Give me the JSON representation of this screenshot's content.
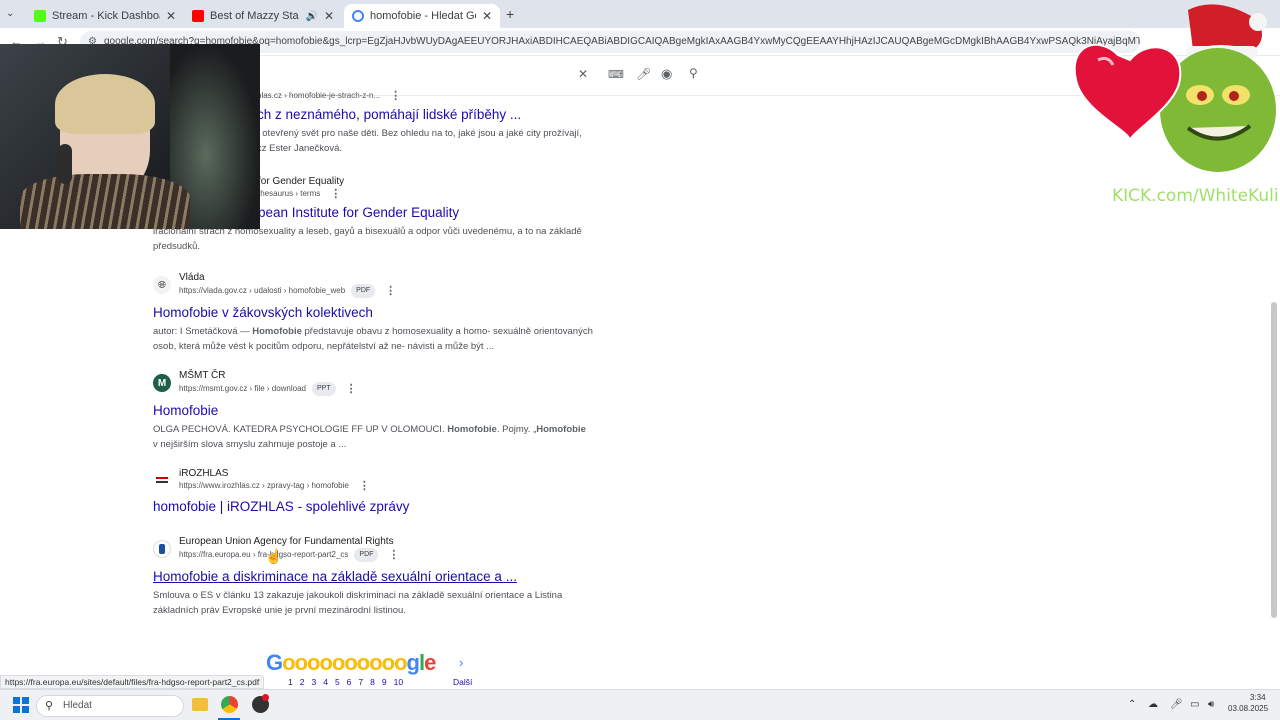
{
  "tabs": [
    {
      "title": "Stream - Kick Dashboard",
      "favicon_color": "#53fc18",
      "active": false
    },
    {
      "title": "Best of Mazzy Star All Time",
      "favicon_color": "#ff0000",
      "active": false
    },
    {
      "title": "homofobie - Hledat Googlem",
      "favicon_color": "#4285f4",
      "active": true
    }
  ],
  "address": {
    "url": "google.com/search?q=homofobie&oq=homofobie&gs_lcrp=EgZjaHJvbWUyDAgAEEUYORJHAxiABDIHCAEQABiABDIGCAIQABgeMgkIAxAAGB4YxwMyCQgEEAAYHhjHAzIJCAUQABgeMGcDMgkIBhAAGB4YxwPSAQk3NjAyajBqMTWoAgiwAgHyBSijnR!I"
  },
  "results": [
    {
      "source": "",
      "url_parts": "hlas.cz › homofobie-je-strach-z-n...",
      "pill": "",
      "title": "ch z neznámého, pomáhají lidské příběhy ...",
      "snippet": "t otevřený svět pro naše děti. Bez ohledu na to, jaké jsou a jaké city prožívají, cz Ester Janečková."
    },
    {
      "source": "for Gender Equality",
      "url_parts": "thesaurus › terms",
      "pill": "",
      "title": "pean Institute for Gender Equality",
      "snippet": "iracionální strach z homosexuality a leseb, gayů a bisexuálů a odpor vůči uvedenému, a to na základě předsudků."
    },
    {
      "source": "Vláda",
      "url_parts": "https://vlada.gov.cz › udalosti › homofobie_web",
      "pill": "PDF",
      "title": "Homofobie v žákovských kolektivech",
      "snippet_a": "autor: I Smetáčková — ",
      "snippet_b": "Homofobie",
      "snippet_c": " představuje obavu z homosexuality a homo- sexuálně orientovaných osob, která může vést k pocitům odporu, nepřátelství až ne- návisti a může být ..."
    },
    {
      "source": "MŠMT ČR",
      "url_parts": "https://msmt.gov.cz › file › download",
      "pill": "PPT",
      "title": "Homofobie",
      "snippet_a": "OLGA PECHOVÁ. KATEDRA PSYCHOLOGIE FF UP V OLOMOUCI. ",
      "snippet_b": "Homofobie",
      "snippet_c": ". Pojmy. „",
      "snippet_d": "Homofobie",
      "snippet_e": " v nejširším slova smyslu zahrnuje postoje a ..."
    },
    {
      "source": "iROZHLAS",
      "url_parts": "https://www.irozhlas.cz › zpravy-tag › homofobie",
      "pill": "",
      "title": "homofobie | iROZHLAS - spolehlivé zprávy",
      "snippet": ""
    },
    {
      "source": "European Union Agency for Fundamental Rights",
      "url_parts": "https://fra.europa.eu › fra-hdgso-report-part2_cs",
      "pill": "PDF",
      "title": "Homofobie a diskriminace na základě sexuální orientace a ...",
      "snippet": "Smlouva o ES v článku 13 zakazuje jakoukoli diskriminaci na základě sexuální orientace a Listina základních práv Evropské unie je první mezinárodní listinou."
    }
  ],
  "pagination": {
    "logo": "Goooooooooogle",
    "pages": [
      "1",
      "2",
      "3",
      "4",
      "5",
      "6",
      "7",
      "8",
      "9",
      "10"
    ],
    "next": "Další"
  },
  "status_url": "https://fra.europa.eu/sites/default/files/fra-hdgso-report-part2_cs.pdf",
  "taskbar": {
    "search_placeholder": "Hledat",
    "time": "3:34",
    "date": "03.08.2025"
  },
  "overlay": {
    "kick_text": "KICK.com/WhiteKuli"
  },
  "colors": {
    "link": "#1a0dab",
    "kick_green": "#9fe06b"
  }
}
